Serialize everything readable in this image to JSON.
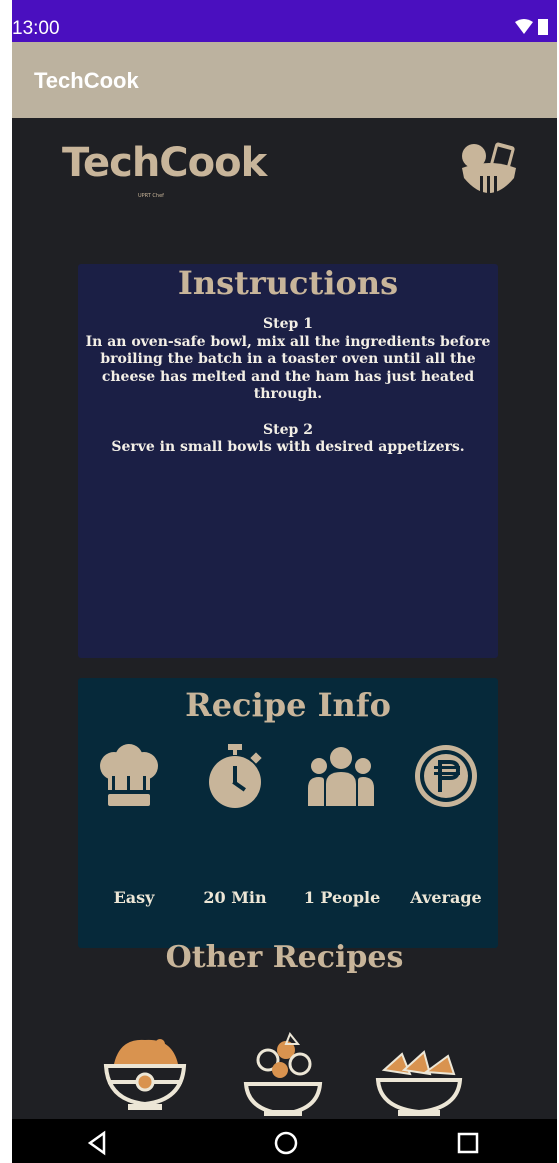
{
  "status_bar": {
    "time": "13:00"
  },
  "app_bar": {
    "title": "TechCook"
  },
  "header": {
    "brand": "TechCook",
    "brand_sub": "UPRT Chef"
  },
  "instructions": {
    "title": "Instructions",
    "steps": [
      {
        "label": "Step 1",
        "text": "In an oven-safe bowl, mix all the ingredients before broiling the batch in a toaster oven until all the cheese has melted and the ham has just heated through."
      },
      {
        "label": "Step 2",
        "text": "Serve in small bowls with desired appetizers."
      }
    ]
  },
  "recipe_info": {
    "title": "Recipe Info",
    "items": [
      {
        "icon": "chef-hat-icon",
        "label": "Easy"
      },
      {
        "icon": "stopwatch-icon",
        "label": "20 Min"
      },
      {
        "icon": "people-icon",
        "label": "1 People"
      },
      {
        "icon": "peso-icon",
        "label": "Average"
      }
    ]
  },
  "other_recipes": {
    "title": "Other Recipes",
    "items": [
      {
        "icon": "dip-bowl-icon"
      },
      {
        "icon": "salad-bowl-icon"
      },
      {
        "icon": "nachos-bowl-icon"
      }
    ]
  },
  "colors": {
    "accent": "#c8b59a",
    "status_bar": "#4a0fbf",
    "app_bar": "#bcb29f",
    "background": "#1f2024",
    "instructions_panel": "#1b1f45",
    "info_panel": "#06293a"
  }
}
